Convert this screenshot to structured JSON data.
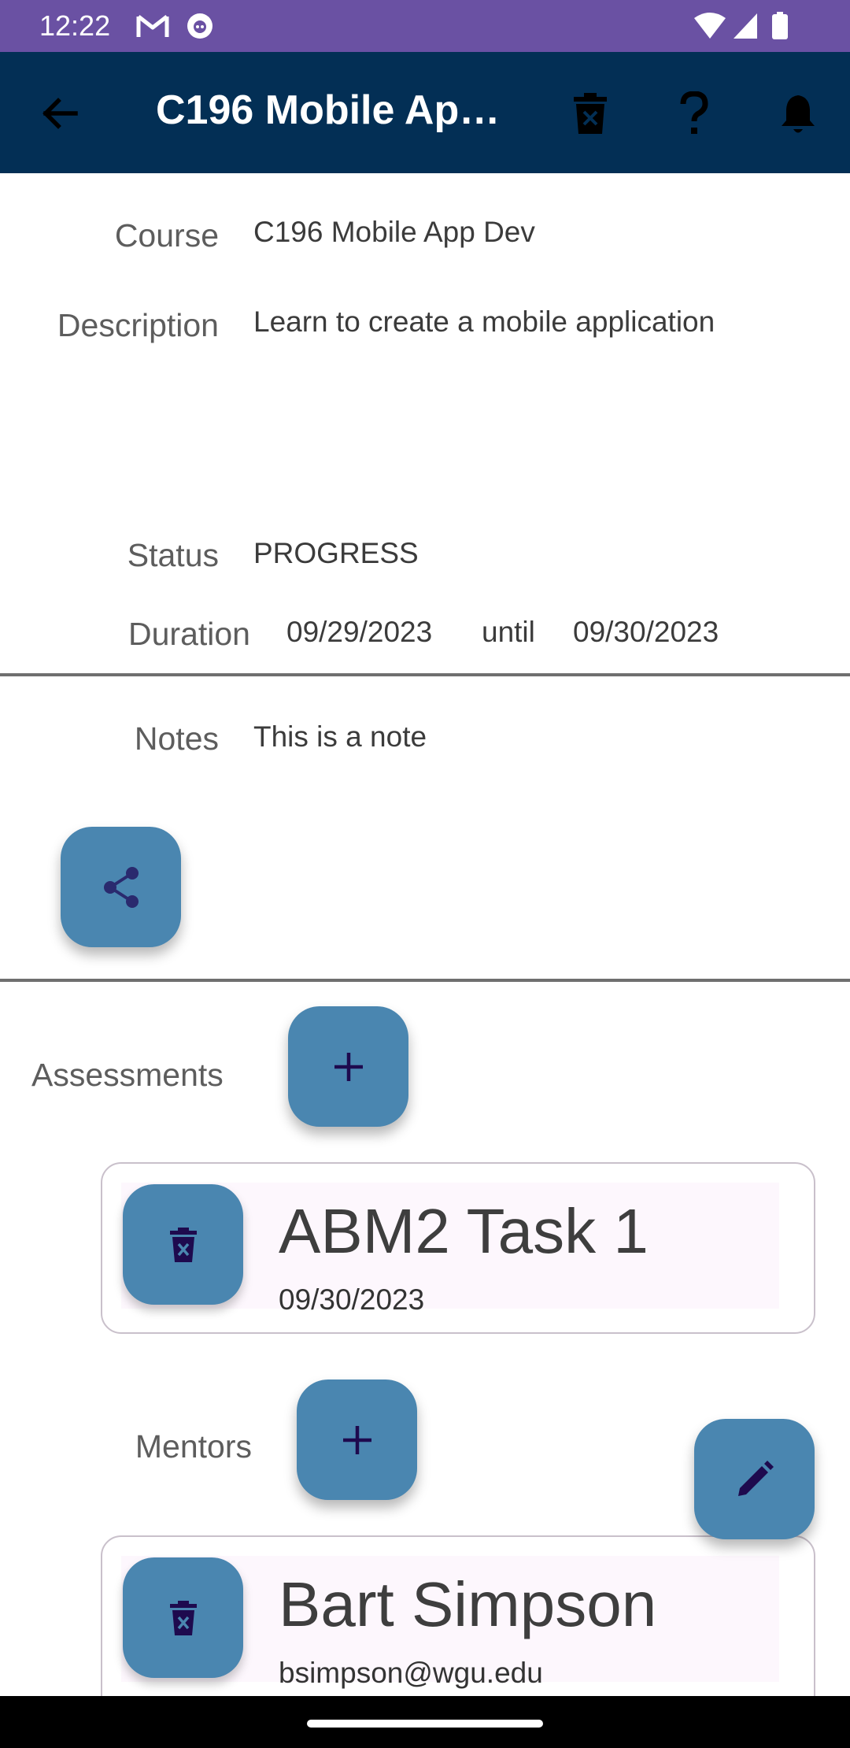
{
  "status_bar": {
    "time": "12:22"
  },
  "app_bar": {
    "title": "C196 Mobile App Dev"
  },
  "details": {
    "course_label": "Course",
    "course_value": "C196 Mobile App Dev",
    "description_label": "Description",
    "description_value": "Learn to create a mobile application",
    "status_label": "Status",
    "status_value": "PROGRESS",
    "duration_label": "Duration",
    "start_date": "09/29/2023",
    "until": "until",
    "end_date": "09/30/2023",
    "notes_label": "Notes",
    "notes_value": "This is a note"
  },
  "assessments": {
    "label": "Assessments",
    "items": [
      {
        "title": "ABM2 Task 1",
        "date": "09/30/2023"
      }
    ]
  },
  "mentors": {
    "label": "Mentors",
    "items": [
      {
        "name": "Bart Simpson",
        "email": "bsimpson@wgu.edu"
      }
    ]
  },
  "colors": {
    "status_bar": "#6a51a3",
    "app_bar": "#032f55",
    "fab": "#4a86b0",
    "fab_icon": "#1e0a4e"
  },
  "icons": {
    "back": "arrow-left-icon",
    "delete": "trash-icon",
    "help": "question-icon",
    "notify": "bell-icon",
    "share": "share-icon",
    "add": "plus-icon",
    "edit": "pencil-icon"
  }
}
